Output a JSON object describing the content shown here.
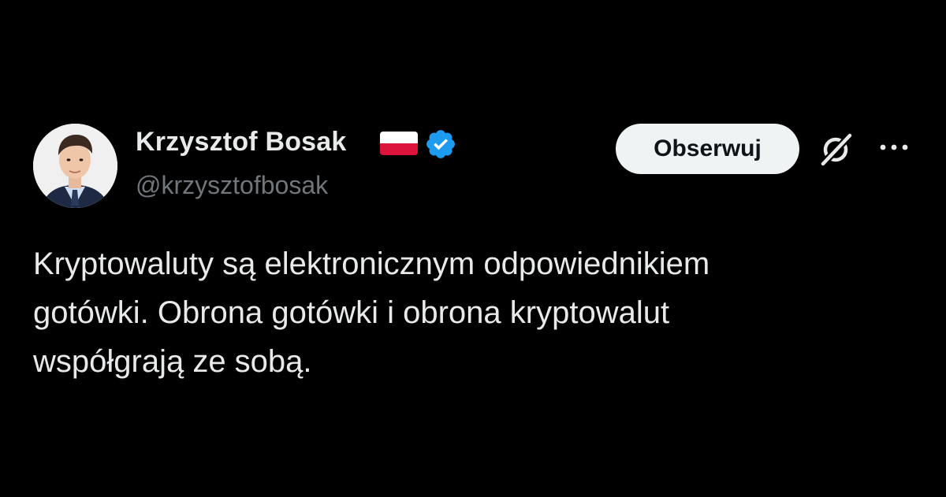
{
  "author": {
    "name": "Krzysztof Bosak",
    "handle": "@krzysztofbosak",
    "flag": "poland-flag",
    "verified_color": "#1d9bf0"
  },
  "actions": {
    "follow_label": "Obserwuj",
    "grok_icon": "grok-icon",
    "more_icon": "more-icon"
  },
  "tweet": {
    "lines": [
      "Kryptowaluty są elektronicznym odpowiednikiem",
      "gotówki. Obrona gotówki i obrona kryptowalut",
      "współgrają ze sobą."
    ]
  },
  "colors": {
    "background": "#000000",
    "text": "#e7e9ea",
    "secondary": "#71767b",
    "button_bg": "#eff3f4"
  }
}
